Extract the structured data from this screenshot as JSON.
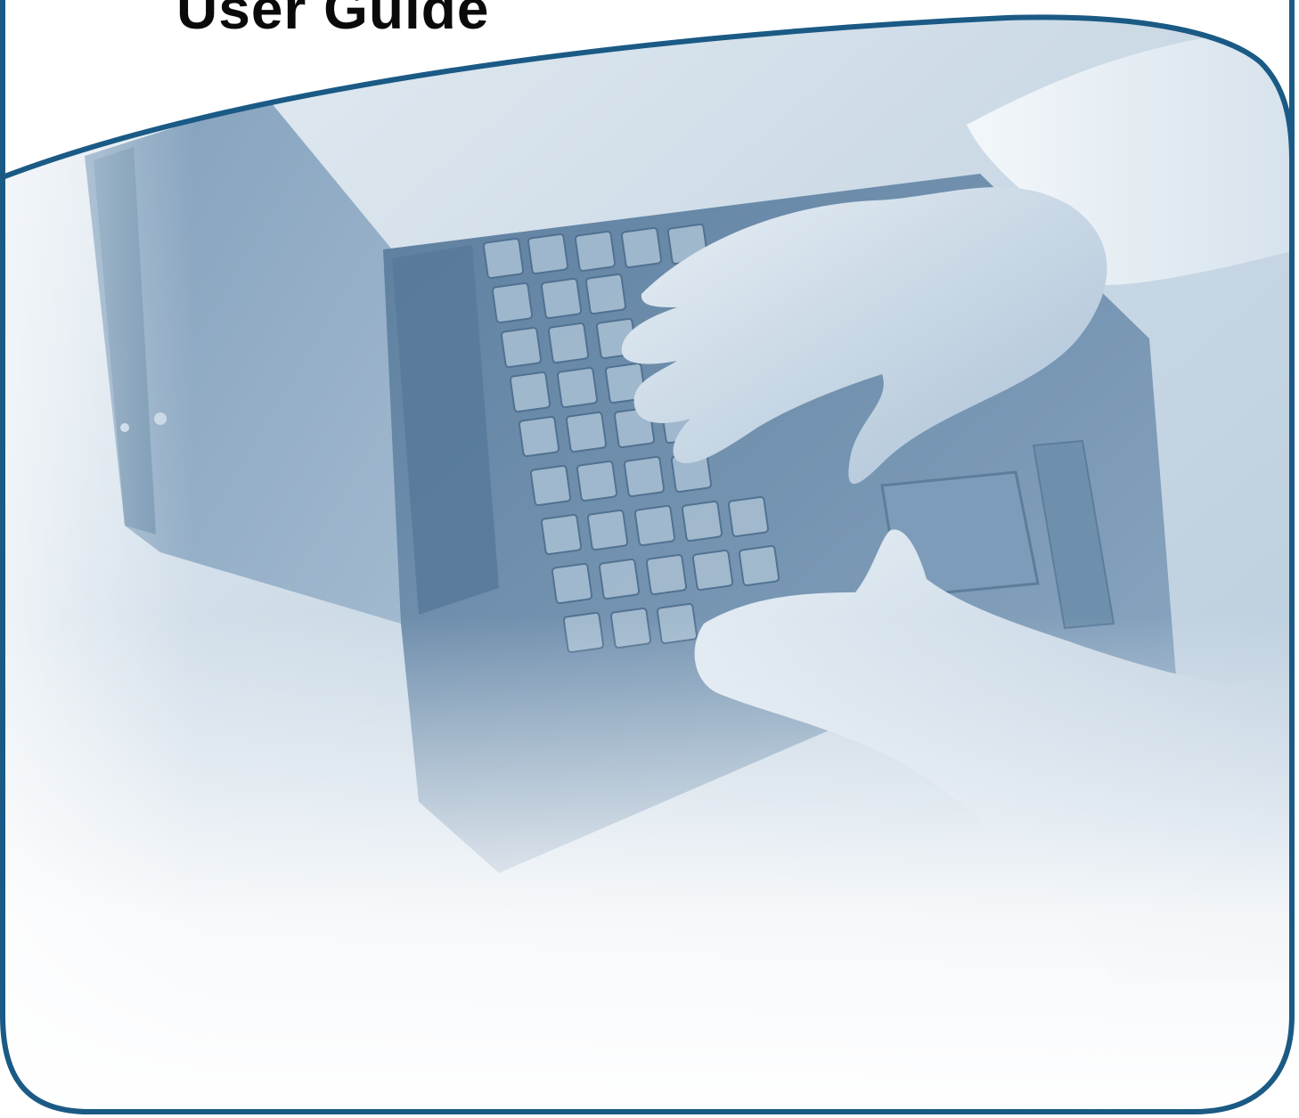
{
  "cover": {
    "title": "User Guide",
    "photo_icon": "laptop-typing-hands-photo",
    "colors": {
      "frame_border": "#1a5a85",
      "photo_tint": "#7e9fbe",
      "photo_light": "#dbe6ef",
      "background": "#ffffff",
      "title_text": "#0a0a0a"
    }
  }
}
